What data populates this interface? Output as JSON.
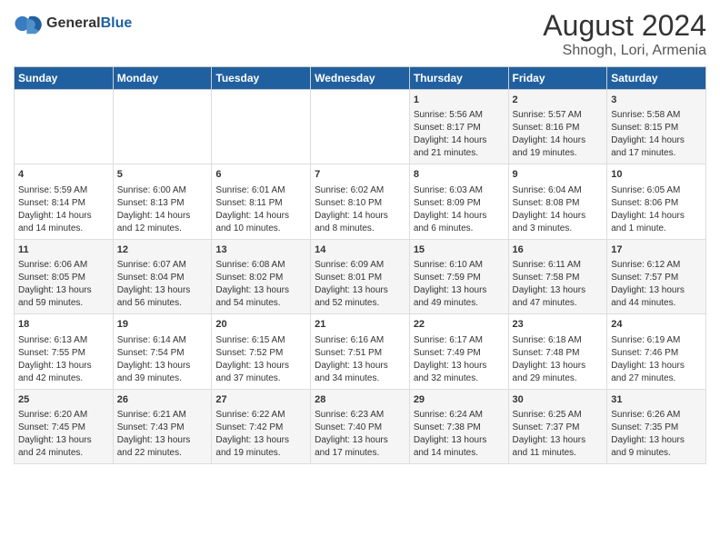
{
  "header": {
    "logo_general": "General",
    "logo_blue": "Blue",
    "title": "August 2024",
    "subtitle": "Shnogh, Lori, Armenia"
  },
  "weekdays": [
    "Sunday",
    "Monday",
    "Tuesday",
    "Wednesday",
    "Thursday",
    "Friday",
    "Saturday"
  ],
  "weeks": [
    [
      {
        "day": "",
        "data": ""
      },
      {
        "day": "",
        "data": ""
      },
      {
        "day": "",
        "data": ""
      },
      {
        "day": "",
        "data": ""
      },
      {
        "day": "1",
        "data": "Sunrise: 5:56 AM\nSunset: 8:17 PM\nDaylight: 14 hours and 21 minutes."
      },
      {
        "day": "2",
        "data": "Sunrise: 5:57 AM\nSunset: 8:16 PM\nDaylight: 14 hours and 19 minutes."
      },
      {
        "day": "3",
        "data": "Sunrise: 5:58 AM\nSunset: 8:15 PM\nDaylight: 14 hours and 17 minutes."
      }
    ],
    [
      {
        "day": "4",
        "data": "Sunrise: 5:59 AM\nSunset: 8:14 PM\nDaylight: 14 hours and 14 minutes."
      },
      {
        "day": "5",
        "data": "Sunrise: 6:00 AM\nSunset: 8:13 PM\nDaylight: 14 hours and 12 minutes."
      },
      {
        "day": "6",
        "data": "Sunrise: 6:01 AM\nSunset: 8:11 PM\nDaylight: 14 hours and 10 minutes."
      },
      {
        "day": "7",
        "data": "Sunrise: 6:02 AM\nSunset: 8:10 PM\nDaylight: 14 hours and 8 minutes."
      },
      {
        "day": "8",
        "data": "Sunrise: 6:03 AM\nSunset: 8:09 PM\nDaylight: 14 hours and 6 minutes."
      },
      {
        "day": "9",
        "data": "Sunrise: 6:04 AM\nSunset: 8:08 PM\nDaylight: 14 hours and 3 minutes."
      },
      {
        "day": "10",
        "data": "Sunrise: 6:05 AM\nSunset: 8:06 PM\nDaylight: 14 hours and 1 minute."
      }
    ],
    [
      {
        "day": "11",
        "data": "Sunrise: 6:06 AM\nSunset: 8:05 PM\nDaylight: 13 hours and 59 minutes."
      },
      {
        "day": "12",
        "data": "Sunrise: 6:07 AM\nSunset: 8:04 PM\nDaylight: 13 hours and 56 minutes."
      },
      {
        "day": "13",
        "data": "Sunrise: 6:08 AM\nSunset: 8:02 PM\nDaylight: 13 hours and 54 minutes."
      },
      {
        "day": "14",
        "data": "Sunrise: 6:09 AM\nSunset: 8:01 PM\nDaylight: 13 hours and 52 minutes."
      },
      {
        "day": "15",
        "data": "Sunrise: 6:10 AM\nSunset: 7:59 PM\nDaylight: 13 hours and 49 minutes."
      },
      {
        "day": "16",
        "data": "Sunrise: 6:11 AM\nSunset: 7:58 PM\nDaylight: 13 hours and 47 minutes."
      },
      {
        "day": "17",
        "data": "Sunrise: 6:12 AM\nSunset: 7:57 PM\nDaylight: 13 hours and 44 minutes."
      }
    ],
    [
      {
        "day": "18",
        "data": "Sunrise: 6:13 AM\nSunset: 7:55 PM\nDaylight: 13 hours and 42 minutes."
      },
      {
        "day": "19",
        "data": "Sunrise: 6:14 AM\nSunset: 7:54 PM\nDaylight: 13 hours and 39 minutes."
      },
      {
        "day": "20",
        "data": "Sunrise: 6:15 AM\nSunset: 7:52 PM\nDaylight: 13 hours and 37 minutes."
      },
      {
        "day": "21",
        "data": "Sunrise: 6:16 AM\nSunset: 7:51 PM\nDaylight: 13 hours and 34 minutes."
      },
      {
        "day": "22",
        "data": "Sunrise: 6:17 AM\nSunset: 7:49 PM\nDaylight: 13 hours and 32 minutes."
      },
      {
        "day": "23",
        "data": "Sunrise: 6:18 AM\nSunset: 7:48 PM\nDaylight: 13 hours and 29 minutes."
      },
      {
        "day": "24",
        "data": "Sunrise: 6:19 AM\nSunset: 7:46 PM\nDaylight: 13 hours and 27 minutes."
      }
    ],
    [
      {
        "day": "25",
        "data": "Sunrise: 6:20 AM\nSunset: 7:45 PM\nDaylight: 13 hours and 24 minutes."
      },
      {
        "day": "26",
        "data": "Sunrise: 6:21 AM\nSunset: 7:43 PM\nDaylight: 13 hours and 22 minutes."
      },
      {
        "day": "27",
        "data": "Sunrise: 6:22 AM\nSunset: 7:42 PM\nDaylight: 13 hours and 19 minutes."
      },
      {
        "day": "28",
        "data": "Sunrise: 6:23 AM\nSunset: 7:40 PM\nDaylight: 13 hours and 17 minutes."
      },
      {
        "day": "29",
        "data": "Sunrise: 6:24 AM\nSunset: 7:38 PM\nDaylight: 13 hours and 14 minutes."
      },
      {
        "day": "30",
        "data": "Sunrise: 6:25 AM\nSunset: 7:37 PM\nDaylight: 13 hours and 11 minutes."
      },
      {
        "day": "31",
        "data": "Sunrise: 6:26 AM\nSunset: 7:35 PM\nDaylight: 13 hours and 9 minutes."
      }
    ]
  ]
}
